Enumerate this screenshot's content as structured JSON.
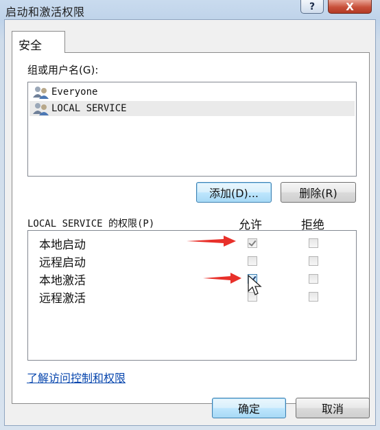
{
  "window": {
    "title": "启动和激活权限",
    "help_glyph": "?",
    "close_glyph": "X"
  },
  "tabs": [
    {
      "label": "安全",
      "selected": true
    }
  ],
  "groups": {
    "label": "组或用户名(G):",
    "items": [
      {
        "name": "Everyone",
        "icon": "users-icon"
      },
      {
        "name": "LOCAL SERVICE",
        "icon": "users-icon",
        "selected": true
      }
    ],
    "add_button": "添加(D)...",
    "remove_button": "删除(R)"
  },
  "permissions": {
    "label": "LOCAL SERVICE 的权限(P)",
    "allow_header": "允许",
    "deny_header": "拒绝",
    "rows": [
      {
        "name": "本地启动",
        "allow": true,
        "deny": false
      },
      {
        "name": "远程启动",
        "allow": false,
        "deny": false
      },
      {
        "name": "本地激活",
        "allow": true,
        "deny": false
      },
      {
        "name": "远程激活",
        "allow": false,
        "deny": false
      }
    ]
  },
  "link": {
    "text": "了解访问控制和权限"
  },
  "footer": {
    "ok_button": "确定",
    "cancel_button": "取消"
  },
  "annotation_color": "#e8302a"
}
